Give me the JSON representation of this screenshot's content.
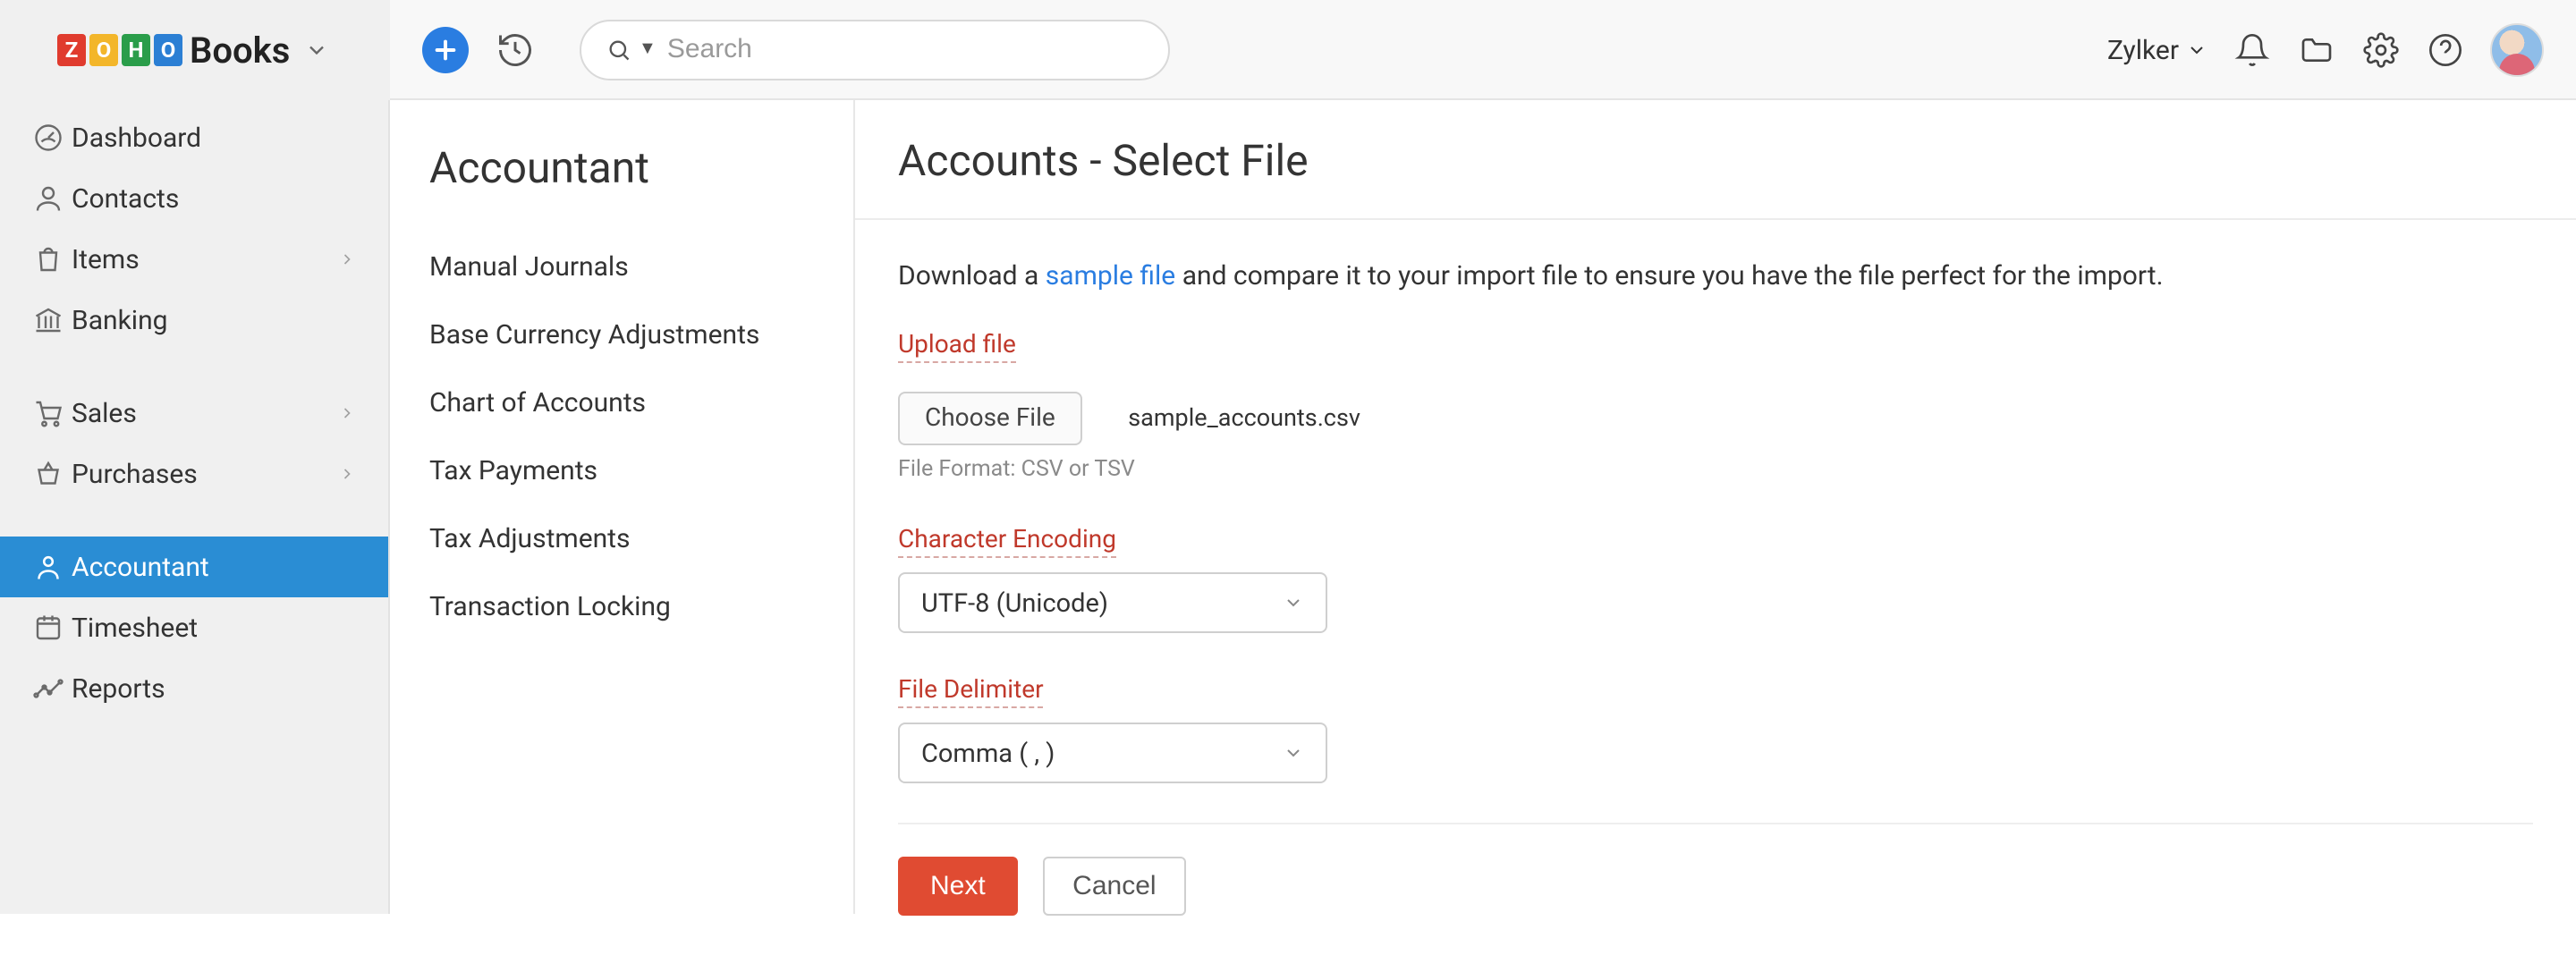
{
  "brand": {
    "books": "Books"
  },
  "header": {
    "search_placeholder": "Search",
    "org_name": "Zylker"
  },
  "sidebar_primary": {
    "items": [
      {
        "label": "Dashboard",
        "icon": "gauge-icon",
        "has_children": false
      },
      {
        "label": "Contacts",
        "icon": "person-icon",
        "has_children": false
      },
      {
        "label": "Items",
        "icon": "bag-icon",
        "has_children": true
      },
      {
        "label": "Banking",
        "icon": "bank-icon",
        "has_children": false
      },
      {
        "gap": true
      },
      {
        "label": "Sales",
        "icon": "cart-icon",
        "has_children": true
      },
      {
        "label": "Purchases",
        "icon": "basket-icon",
        "has_children": true
      },
      {
        "gap": true
      },
      {
        "label": "Accountant",
        "icon": "badge-icon",
        "has_children": false,
        "active": true
      },
      {
        "label": "Timesheet",
        "icon": "calendar-icon",
        "has_children": false
      },
      {
        "label": "Reports",
        "icon": "graph-icon",
        "has_children": false
      }
    ]
  },
  "sidebar_secondary": {
    "title": "Accountant",
    "items": [
      "Manual Journals",
      "Base Currency Adjustments",
      "Chart of Accounts",
      "Tax Payments",
      "Tax Adjustments",
      "Transaction Locking"
    ]
  },
  "main": {
    "title": "Accounts - Select File",
    "instruction_prefix": "Download a ",
    "sample_link": "sample file",
    "instruction_suffix": " and compare it to your import file to ensure you have the file perfect for the import.",
    "upload_label": "Upload file",
    "choose_file": "Choose File",
    "chosen_filename": "sample_accounts.csv",
    "file_format_hint": "File Format: CSV or TSV",
    "encoding_label": "Character Encoding",
    "encoding_value": "UTF-8 (Unicode)",
    "delimiter_label": "File Delimiter",
    "delimiter_value": "Comma ( , )",
    "next": "Next",
    "cancel": "Cancel"
  }
}
